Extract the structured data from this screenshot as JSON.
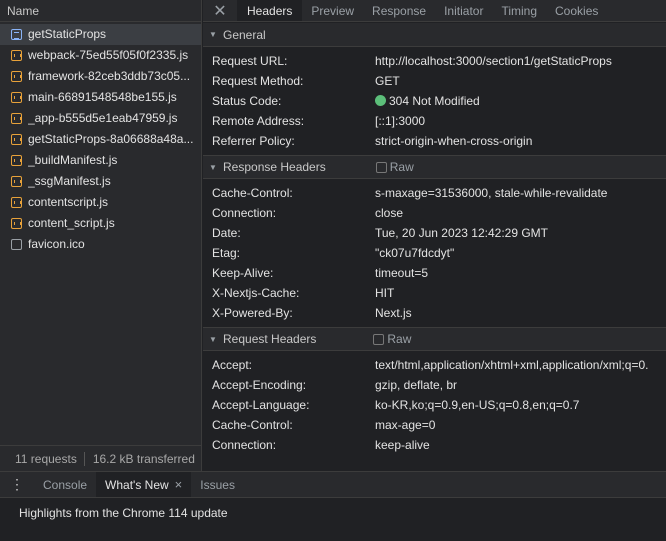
{
  "left": {
    "header": "Name",
    "files": [
      {
        "name": "getStaticProps",
        "type": "doc",
        "selected": true
      },
      {
        "name": "webpack-75ed55f05f0f2335.js",
        "type": "js"
      },
      {
        "name": "framework-82ceb3ddb73c05...",
        "type": "js"
      },
      {
        "name": "main-66891548548be155.js",
        "type": "js"
      },
      {
        "name": "_app-b555d5e1eab47959.js",
        "type": "js"
      },
      {
        "name": "getStaticProps-8a06688a48a...",
        "type": "js"
      },
      {
        "name": "_buildManifest.js",
        "type": "js"
      },
      {
        "name": "_ssgManifest.js",
        "type": "js"
      },
      {
        "name": "contentscript.js",
        "type": "js"
      },
      {
        "name": "content_script.js",
        "type": "js"
      },
      {
        "name": "favicon.ico",
        "type": "img"
      }
    ],
    "footer": {
      "requests": "11 requests",
      "transferred": "16.2 kB transferred"
    }
  },
  "tabs": {
    "close_icon": "close-icon",
    "items": [
      "Headers",
      "Preview",
      "Response",
      "Initiator",
      "Timing",
      "Cookies"
    ],
    "active": "Headers"
  },
  "sections": {
    "general": {
      "title": "General",
      "rows": [
        {
          "k": "Request URL:",
          "v": "http://localhost:3000/section1/getStaticProps"
        },
        {
          "k": "Request Method:",
          "v": "GET"
        },
        {
          "k": "Status Code:",
          "v": "304 Not Modified",
          "status_color": "#5cbf7a"
        },
        {
          "k": "Remote Address:",
          "v": "[::1]:3000"
        },
        {
          "k": "Referrer Policy:",
          "v": "strict-origin-when-cross-origin"
        }
      ]
    },
    "response": {
      "title": "Response Headers",
      "raw_label": "Raw",
      "rows": [
        {
          "k": "Cache-Control:",
          "v": "s-maxage=31536000, stale-while-revalidate"
        },
        {
          "k": "Connection:",
          "v": "close"
        },
        {
          "k": "Date:",
          "v": "Tue, 20 Jun 2023 12:42:29 GMT"
        },
        {
          "k": "Etag:",
          "v": "\"ck07u7fdcdyt\""
        },
        {
          "k": "Keep-Alive:",
          "v": "timeout=5"
        },
        {
          "k": "X-Nextjs-Cache:",
          "v": "HIT"
        },
        {
          "k": "X-Powered-By:",
          "v": "Next.js"
        }
      ]
    },
    "request": {
      "title": "Request Headers",
      "raw_label": "Raw",
      "rows": [
        {
          "k": "Accept:",
          "v": "text/html,application/xhtml+xml,application/xml;q=0."
        },
        {
          "k": "Accept-Encoding:",
          "v": "gzip, deflate, br"
        },
        {
          "k": "Accept-Language:",
          "v": "ko-KR,ko;q=0.9,en-US;q=0.8,en;q=0.7"
        },
        {
          "k": "Cache-Control:",
          "v": "max-age=0"
        },
        {
          "k": "Connection:",
          "v": "keep-alive"
        }
      ]
    }
  },
  "drawer": {
    "tabs": [
      {
        "label": "Console"
      },
      {
        "label": "What's New",
        "active": true,
        "closable": true
      },
      {
        "label": "Issues"
      }
    ],
    "content": "Highlights from the Chrome 114 update"
  }
}
